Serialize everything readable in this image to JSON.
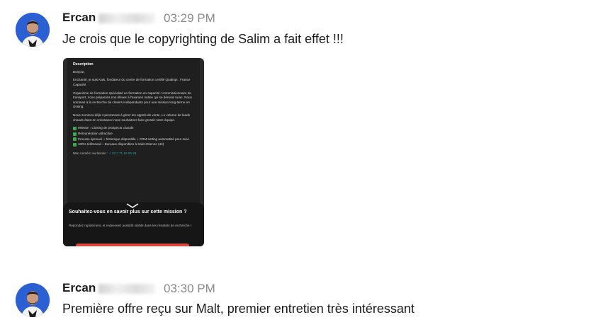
{
  "messages": [
    {
      "author": "Ercan",
      "time": "03:29 PM",
      "text": "Je crois que le copyrighting de Salim a fait effet !!!",
      "attachment": {
        "title": "Description",
        "greeting": "Bonjour,",
        "para1": "Enchanté, je suis Kais, fondateur du centre de formation certifié Qualiopi : France Capacité.",
        "para2": "Organisme de formation spécialisé en formation en capacité / commissionnaire de transport, nous préparons nos élèves à l'examen nation qui se déroule tu/an. Nous sommes à la recherche de closers indépendants pour une mission long-terme en closing.",
        "para3": "Nous sommes déjà 4 personnes à gérer les appels de vente. Le volume de leads chauds étant en croissance nous souhaitons faire grossir notre équipe.",
        "checks": [
          "Mission : Closing de prospects chauds",
          "Rémunération attractive",
          "Process éprouvé + historique disponible + CRM setting automatisé pour suivi",
          "100% télétravail – Bureaux disponibles à Saint-Etienne (42)"
        ],
        "phone_label": "Mon numéro au besoin :",
        "phone_value": "+ 33 7 71 16 56 38",
        "overlay_question": "Souhaitez-vous en savoir plus sur cette mission ?",
        "overlay_text": "Répondez rapidement, et redevenez aussitôt visible dans les résultats de recherche !"
      }
    },
    {
      "author": "Ercan",
      "time": "03:30 PM",
      "text": "Première offre reçu sur Malt, premier entretien très intéressant"
    }
  ],
  "colors": {
    "avatar_bg": "#2b5fd4",
    "timestamp": "#8a8a8a",
    "check": "#3aa851",
    "phone": "#2aa3a6"
  }
}
